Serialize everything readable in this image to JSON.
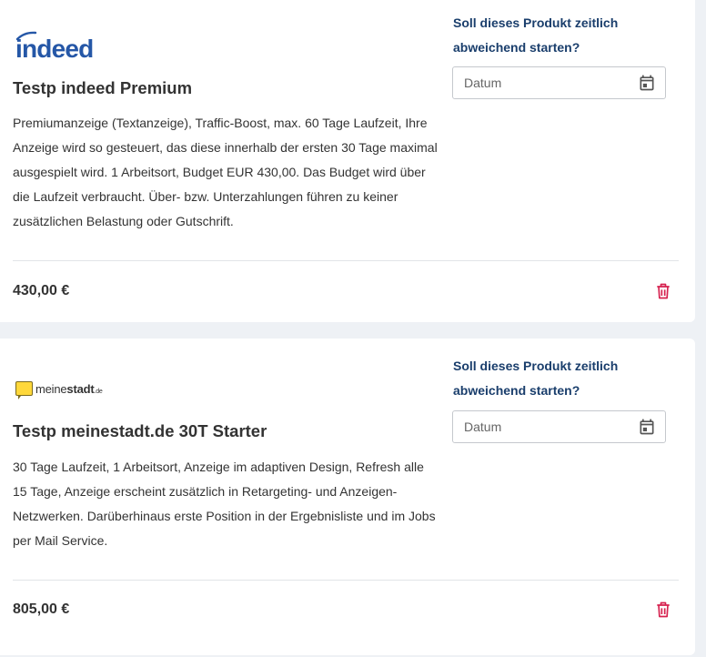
{
  "products": [
    {
      "logo": {
        "text": "indeed",
        "color": "#2557a7"
      },
      "title": "Testp indeed Premium",
      "description": "Premiumanzeige (Textanzeige), Traffic-Boost, max. 60 Tage Laufzeit, Ihre Anzeige wird so gesteuert, das diese innerhalb der ersten 30 Tage maximal ausgespielt wird. 1 Arbeitsort, Budget EUR 430,00. Das Budget wird über die Laufzeit verbraucht. Über- bzw. Unterzahlungen führen zu keiner zusätzlichen Belastung oder Gutschrift.",
      "price": "430,00 €",
      "question": "Soll dieses Produkt zeitlich abweichend starten?",
      "date_placeholder": "Datum",
      "icons": {
        "date": "calendar-icon",
        "delete": "trash-icon"
      }
    },
    {
      "logo": {
        "text_regular": "meine",
        "text_bold": "stadt",
        "suffix": ".de",
        "accent": "#ffd83b"
      },
      "title": "Testp meinestadt.de 30T Starter",
      "description": "30 Tage Laufzeit, 1 Arbeitsort, Anzeige im adaptiven Design, Refresh alle 15 Tage, Anzeige erscheint zusätzlich in Retargeting- und Anzeigen-Netzwerken. Darüberhinaus erste Position in der Ergebnisliste und im Jobs per Mail Service.",
      "price": "805,00 €",
      "question": "Soll dieses Produkt zeitlich abweichend starten?",
      "date_placeholder": "Datum",
      "icons": {
        "date": "calendar-icon",
        "delete": "trash-icon"
      }
    }
  ],
  "colors": {
    "question": "#1a3e6c",
    "delete": "#d6204e",
    "calendar": "#555555"
  }
}
